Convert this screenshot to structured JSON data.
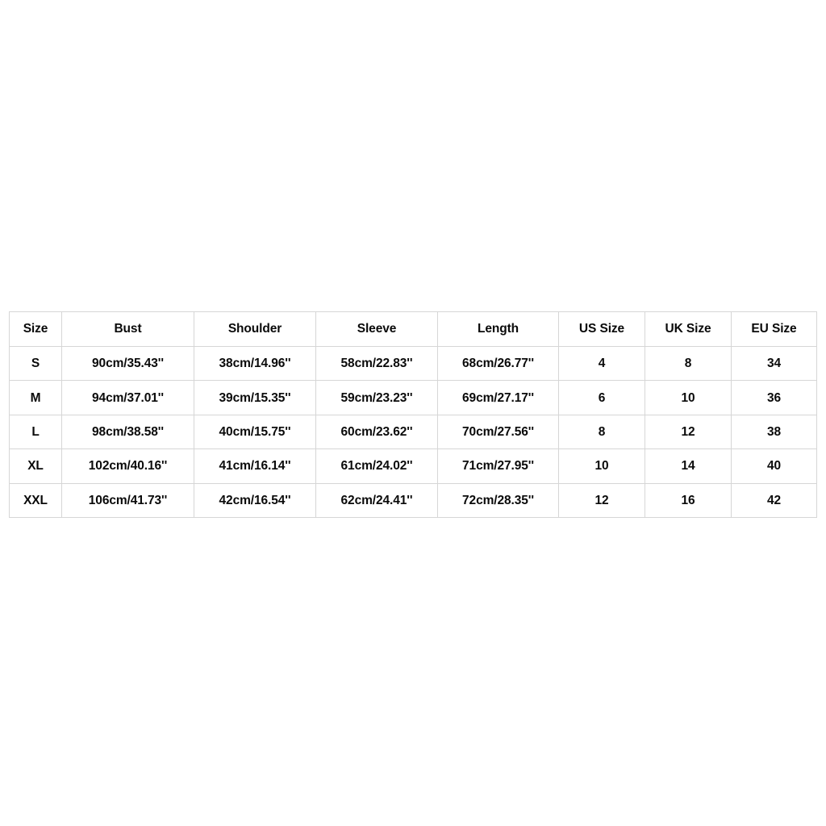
{
  "table": {
    "name": "size-chart",
    "columns": [
      "Size",
      "Bust",
      "Shoulder",
      "Sleeve",
      "Length",
      "US Size",
      "UK Size",
      "EU Size"
    ],
    "rows": [
      {
        "size": "S",
        "bust": "90cm/35.43''",
        "shoulder": "38cm/14.96''",
        "sleeve": "58cm/22.83''",
        "length": "68cm/26.77''",
        "us": "4",
        "uk": "8",
        "eu": "34"
      },
      {
        "size": "M",
        "bust": "94cm/37.01''",
        "shoulder": "39cm/15.35''",
        "sleeve": "59cm/23.23''",
        "length": "69cm/27.17''",
        "us": "6",
        "uk": "10",
        "eu": "36"
      },
      {
        "size": "L",
        "bust": "98cm/38.58''",
        "shoulder": "40cm/15.75''",
        "sleeve": "60cm/23.62''",
        "length": "70cm/27.56''",
        "us": "8",
        "uk": "12",
        "eu": "38"
      },
      {
        "size": "XL",
        "bust": "102cm/40.16''",
        "shoulder": "41cm/16.14''",
        "sleeve": "61cm/24.02''",
        "length": "71cm/27.95''",
        "us": "10",
        "uk": "14",
        "eu": "40"
      },
      {
        "size": "XXL",
        "bust": "106cm/41.73''",
        "shoulder": "42cm/16.54''",
        "sleeve": "62cm/24.41''",
        "length": "72cm/28.35''",
        "us": "12",
        "uk": "16",
        "eu": "42"
      }
    ]
  },
  "colors": {
    "page_background": "#ffffff",
    "cell_background": "#ffffff",
    "border": "#d6d6d6",
    "text": "#0a0a0a"
  }
}
